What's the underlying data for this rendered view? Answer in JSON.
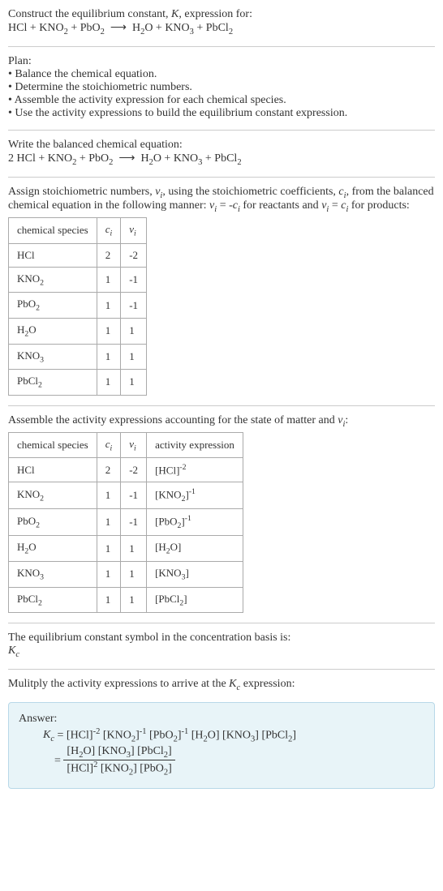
{
  "header": {
    "line1": "Construct the equilibrium constant, K, expression for:",
    "equation": "HCl + KNO₂ + PbO₂ ⟶ H₂O + KNO₃ + PbCl₂"
  },
  "plan": {
    "title": "Plan:",
    "items": [
      "• Balance the chemical equation.",
      "• Determine the stoichiometric numbers.",
      "• Assemble the activity expression for each chemical species.",
      "• Use the activity expressions to build the equilibrium constant expression."
    ]
  },
  "balanced": {
    "intro": "Write the balanced chemical equation:",
    "equation": "2 HCl + KNO₂ + PbO₂ ⟶ H₂O + KNO₃ + PbCl₂"
  },
  "stoich": {
    "intro": "Assign stoichiometric numbers, νᵢ, using the stoichiometric coefficients, cᵢ, from the balanced chemical equation in the following manner: νᵢ = -cᵢ for reactants and νᵢ = cᵢ for products:",
    "headers": [
      "chemical species",
      "cᵢ",
      "νᵢ"
    ],
    "rows": [
      {
        "species": "HCl",
        "c": "2",
        "v": "-2"
      },
      {
        "species": "KNO₂",
        "c": "1",
        "v": "-1"
      },
      {
        "species": "PbO₂",
        "c": "1",
        "v": "-1"
      },
      {
        "species": "H₂O",
        "c": "1",
        "v": "1"
      },
      {
        "species": "KNO₃",
        "c": "1",
        "v": "1"
      },
      {
        "species": "PbCl₂",
        "c": "1",
        "v": "1"
      }
    ]
  },
  "activity": {
    "intro": "Assemble the activity expressions accounting for the state of matter and νᵢ:",
    "headers": [
      "chemical species",
      "cᵢ",
      "νᵢ",
      "activity expression"
    ],
    "rows": [
      {
        "species": "HCl",
        "c": "2",
        "v": "-2",
        "expr": "[HCl]⁻²"
      },
      {
        "species": "KNO₂",
        "c": "1",
        "v": "-1",
        "expr": "[KNO₂]⁻¹"
      },
      {
        "species": "PbO₂",
        "c": "1",
        "v": "-1",
        "expr": "[PbO₂]⁻¹"
      },
      {
        "species": "H₂O",
        "c": "1",
        "v": "1",
        "expr": "[H₂O]"
      },
      {
        "species": "KNO₃",
        "c": "1",
        "v": "1",
        "expr": "[KNO₃]"
      },
      {
        "species": "PbCl₂",
        "c": "1",
        "v": "1",
        "expr": "[PbCl₂]"
      }
    ]
  },
  "eqconst": {
    "line1": "The equilibrium constant symbol in the concentration basis is:",
    "symbol": "K_c"
  },
  "multiply": {
    "text": "Mulitply the activity expressions to arrive at the K_c expression:"
  },
  "answer": {
    "label": "Answer:",
    "line1_left": "K_c = ",
    "line1_right": "[HCl]⁻² [KNO₂]⁻¹ [PbO₂]⁻¹ [H₂O] [KNO₃] [PbCl₂]",
    "line2_left": "= ",
    "frac_top": "[H₂O] [KNO₃] [PbCl₂]",
    "frac_bot": "[HCl]² [KNO₂] [PbO₂]"
  }
}
